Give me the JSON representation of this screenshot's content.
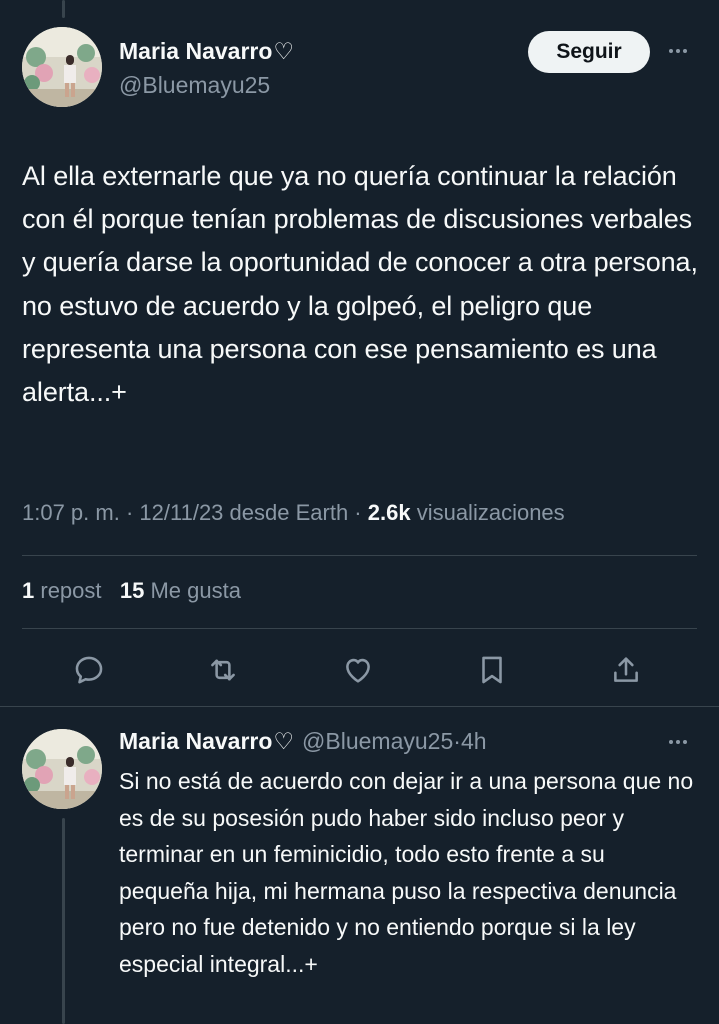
{
  "tweet": {
    "author_name": "Maria Navarro",
    "author_name_suffix": "♡",
    "handle": "@Bluemayu25",
    "follow_label": "Seguir",
    "text": "Al ella externarle que ya no quería continuar la relación con él porque tenían problemas de discusiones verbales y quería darse la oportunidad de conocer a otra persona, no estuvo de acuerdo y la golpeó, el peligro que representa una persona con ese pensamiento es una alerta...+",
    "time": "1:07 p. m.",
    "separator": " · ",
    "date": "12/11/23",
    "source": "desde Earth",
    "views_count": "2.6k",
    "views_label": "visualizaciones",
    "reposts_count": "1",
    "reposts_label": "repost",
    "likes_count": "15",
    "likes_label": "Me gusta"
  },
  "actions": [
    {
      "name": "reply",
      "icon": "reply-icon"
    },
    {
      "name": "repost",
      "icon": "repost-icon"
    },
    {
      "name": "like",
      "icon": "heart-icon"
    },
    {
      "name": "bookmark",
      "icon": "bookmark-icon"
    },
    {
      "name": "share",
      "icon": "share-icon"
    }
  ],
  "reply": {
    "author_name": "Maria Navarro",
    "author_name_suffix": "♡",
    "handle": "@Bluemayu25",
    "dot": " · ",
    "time_ago": "4h",
    "text": "Si no está de acuerdo con dejar ir a una persona que no es de su posesión pudo haber sido incluso peor y terminar en un feminicidio, todo esto frente a su pequeña hija, mi hermana puso la respectiva denuncia pero no fue detenido y no entiendo porque si la ley especial integral...+"
  },
  "colors": {
    "background": "#15202b",
    "text": "#f7f9f9",
    "muted": "#8b98a5",
    "divider": "#38444d",
    "button_bg": "#eff3f4"
  }
}
